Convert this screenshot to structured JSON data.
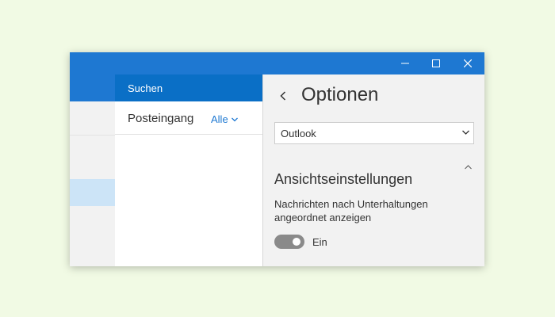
{
  "window": {
    "controls": [
      "minimize-icon",
      "maximize-icon",
      "close-icon"
    ]
  },
  "list": {
    "search_label": "Suchen",
    "folder_label": "Posteingang",
    "filter_label": "Alle"
  },
  "options": {
    "title": "Optionen",
    "account_selected": "Outlook",
    "section_title": "Ansichtseinstellungen",
    "setting_description_line1": "Nachrichten nach Unterhaltungen",
    "setting_description_line2": "angeordnet anzeigen",
    "toggle_state_label": "Ein",
    "toggle_on": true
  },
  "colors": {
    "accent": "#1e78d2",
    "selected_search": "#0a6fc6",
    "nav_selected": "#cce4f7",
    "background": "#f1fae4"
  }
}
